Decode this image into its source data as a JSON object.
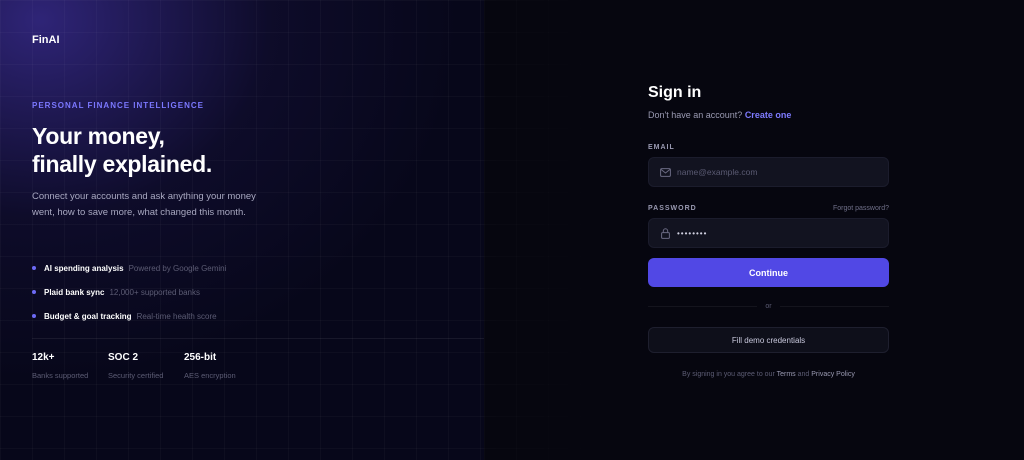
{
  "brand": {
    "logo": "FinAI"
  },
  "hero": {
    "eyebrow": "PERSONAL FINANCE INTELLIGENCE",
    "headline_line1": "Your money,",
    "headline_line2": "finally explained.",
    "description": "Connect your accounts and ask anything your money went, how to save more, what changed this month.",
    "features": [
      {
        "title": "AI spending analysis",
        "subtitle": "Powered by Google Gemini"
      },
      {
        "title": "Plaid bank sync",
        "subtitle": "12,000+ supported banks"
      },
      {
        "title": "Budget & goal tracking",
        "subtitle": "Real-time health score"
      }
    ],
    "stats": [
      {
        "value": "12k+",
        "label": "Banks supported"
      },
      {
        "value": "SOC 2",
        "label": "Security certified"
      },
      {
        "value": "256-bit",
        "label": "AES encryption"
      }
    ]
  },
  "signin": {
    "title": "Sign in",
    "subtitle_prefix": "Don't have an account?",
    "create_link": "Create one",
    "email_label": "EMAIL",
    "email_placeholder": "name@example.com",
    "password_label": "PASSWORD",
    "forgot_link": "Forgot password?",
    "password_value": "••••••••",
    "continue_label": "Continue",
    "or_label": "or",
    "demo_label": "Fill demo credentials",
    "terms_prefix": "By signing in you agree to our",
    "terms_link": "Terms",
    "terms_and": "and",
    "privacy_link": "Privacy Policy"
  },
  "colors": {
    "accent": "#5148e5",
    "link": "#7e7bff",
    "background": "#06060f"
  },
  "icons": {
    "email": "mail-icon",
    "password": "lock-icon"
  }
}
